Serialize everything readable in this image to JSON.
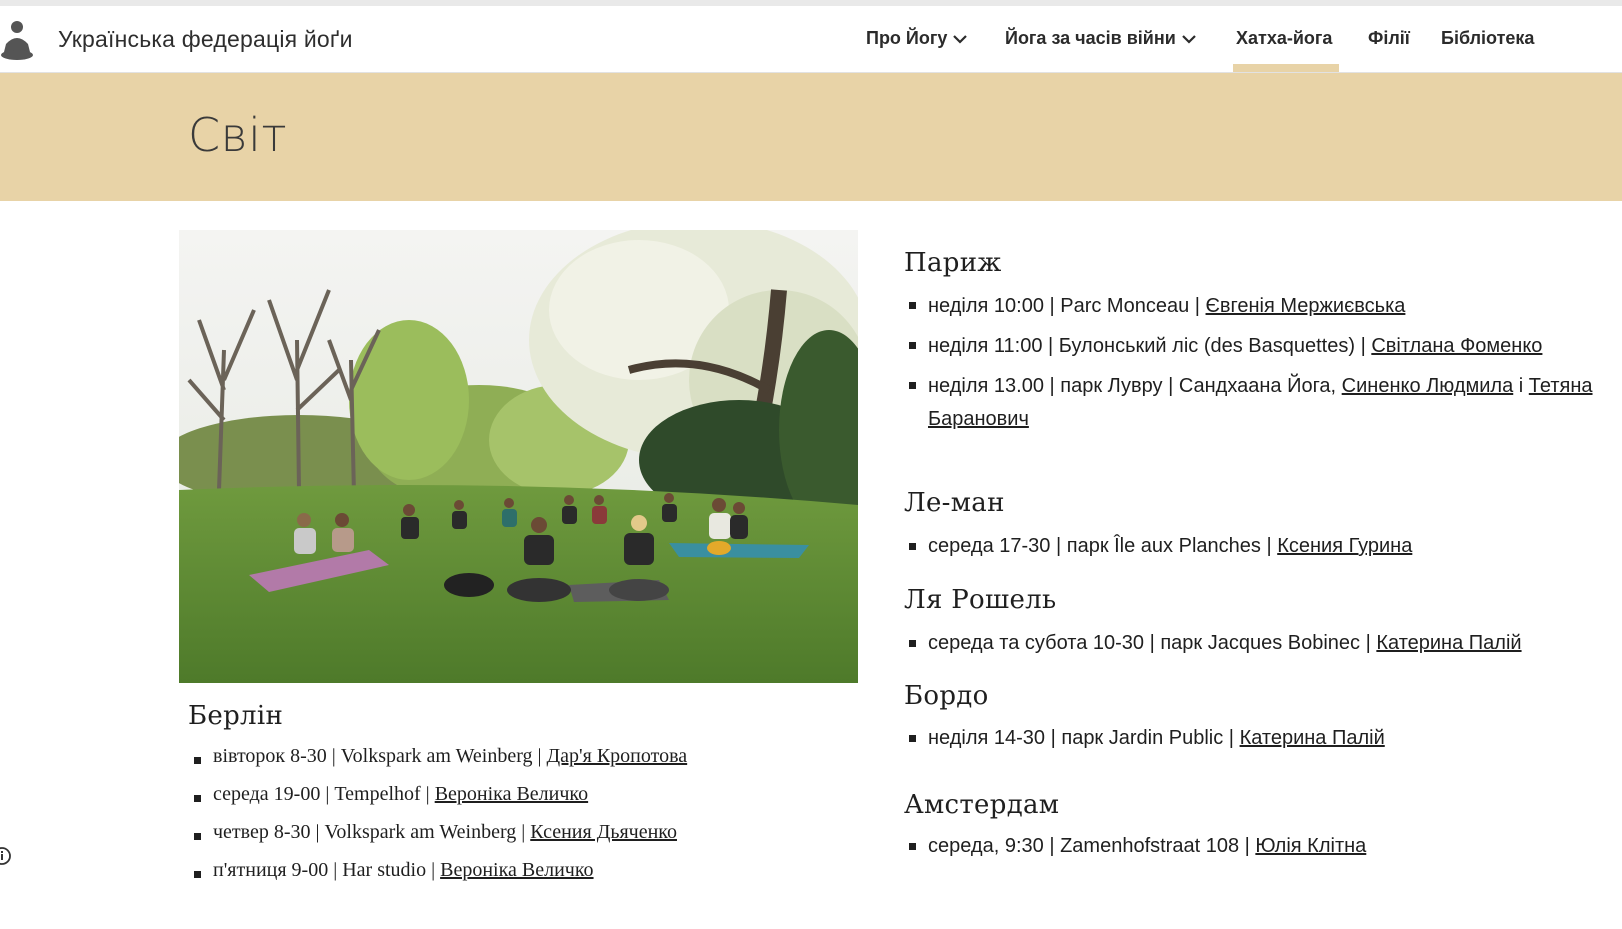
{
  "header": {
    "site_title": "Українська федерація йоґи",
    "nav": [
      {
        "label": "Про Йогу",
        "dropdown": true
      },
      {
        "label": "Йога за часів війни",
        "dropdown": true
      },
      {
        "label": "Хатха-йога",
        "active": true
      },
      {
        "label": "Філії"
      },
      {
        "label": "Бібліотека"
      }
    ]
  },
  "banner": {
    "title": "Світ"
  },
  "colors": {
    "banner": "#e8d3a7",
    "active_tab": "#e8d3a7",
    "text": "#1f1f1f"
  },
  "berlin": {
    "city": "Берлін",
    "items": [
      {
        "text": "вівторок 8-30 | Volkspark am Weinberg  | ",
        "link": "Дар'я Кропотова"
      },
      {
        "text": "середа 19-00 | Tempelhof | ",
        "link": "Вероніка Величко"
      },
      {
        "text": "четвер 8-30 | Volkspark am Weinberg | ",
        "link": "Ксения Дьяченко"
      },
      {
        "text": "п'ятниця 9-00 | Har studio | ",
        "link": "Вероніка Величко"
      }
    ]
  },
  "paris": {
    "city": "Париж",
    "items": [
      {
        "text": "неділя 10:00 | Parc Monceau | ",
        "link": "Євгенія Мержиєвська"
      },
      {
        "text": "неділя 11:00 | Булонський ліс (des Basquettes) | ",
        "link": "Світлана Фоменко"
      },
      {
        "text": "неділя 13.00 | парк Лувру  | Сандхаана Йога, ",
        "link": "Синенко Людмила",
        "mid": " і ",
        "link2": "Тетяна Баранович"
      }
    ]
  },
  "leman": {
    "city": "Ле-ман",
    "items": [
      {
        "text": "середа 17-30 | парк Île aux Planches |  ",
        "link": "Ксения Гурина"
      }
    ]
  },
  "larochelle": {
    "city": "Ля Рошель",
    "items": [
      {
        "text": "середа та субота 10-30 | парк Jacques Bobinec | ",
        "link": "Катерина Палій"
      }
    ]
  },
  "bordeaux": {
    "city": "Бордо",
    "items": [
      {
        "text": "неділя 14-30 | парк Jardin Public | ",
        "link": "Катерина Палій"
      }
    ]
  },
  "amsterdam": {
    "city": "Амстердам",
    "items": [
      {
        "text": "середа, 9:30 | Zamenhofstraat 108 | ",
        "link": "Юлія Клітна"
      }
    ]
  }
}
